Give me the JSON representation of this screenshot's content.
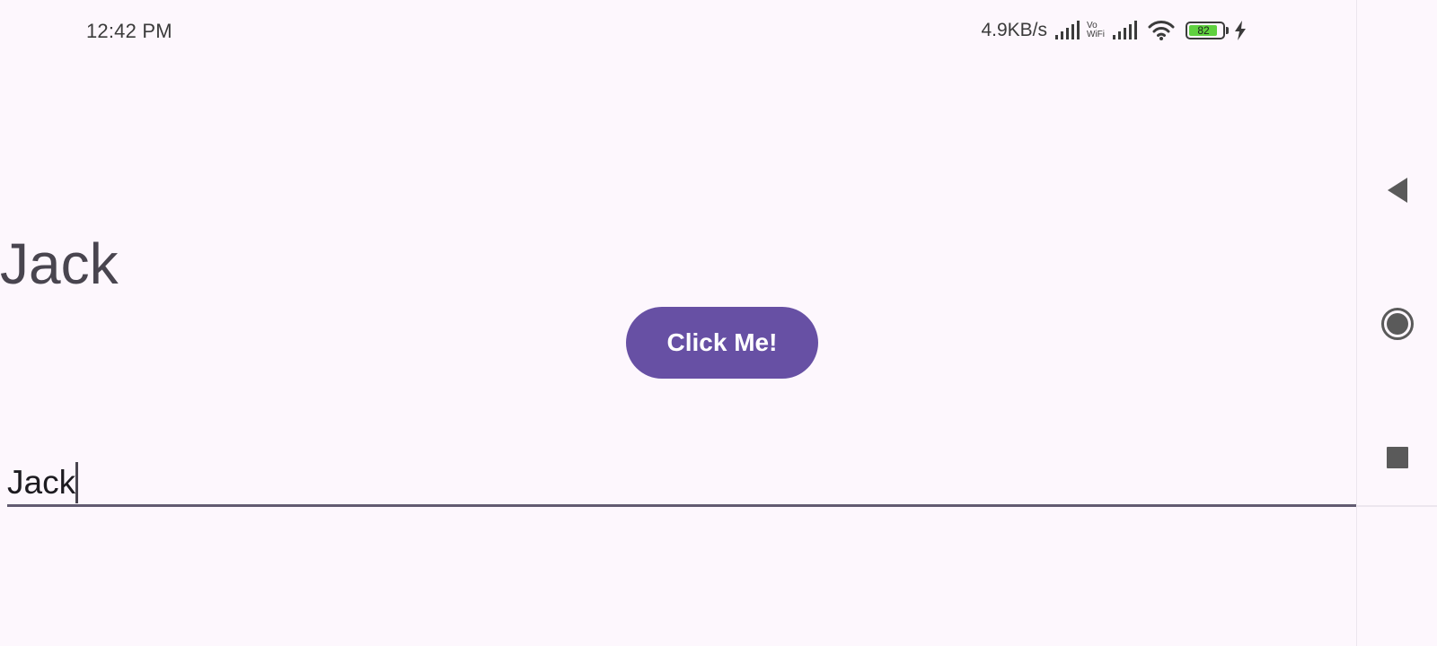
{
  "status_bar": {
    "time": "12:42 PM",
    "net_speed": "4.9KB/s",
    "vowifi_top": "Vo",
    "vowifi_bottom": "WiFi",
    "battery_level": "82",
    "icons": [
      "cellular-signal-icon",
      "vowifi-icon",
      "cellular-signal-icon",
      "wifi-icon",
      "battery-icon",
      "charging-bolt-icon"
    ]
  },
  "main": {
    "name_text": "Jack",
    "button_label": "Click Me!",
    "input_value": "Jack"
  },
  "nav_bar": {
    "icons": [
      "back-icon",
      "home-icon",
      "recents-icon"
    ]
  },
  "colors": {
    "background": "#fdf7fd",
    "primary": "#6750a4",
    "on_primary": "#ffffff",
    "text_secondary": "#49454f",
    "underline": "#625b71",
    "battery_fill": "#5fd13f"
  }
}
